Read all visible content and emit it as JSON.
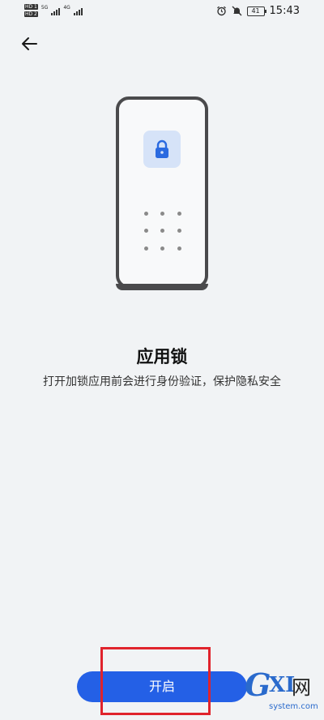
{
  "status_bar": {
    "sim1": "HD 1",
    "sim2": "HD 2",
    "net1": "5G",
    "net2": "4G",
    "battery": "41",
    "time": "15:43"
  },
  "header": {
    "back_icon": "arrow-left-icon"
  },
  "illustration": {
    "icon": "lock-icon",
    "accent": "#2a6ae0"
  },
  "content": {
    "title": "应用锁",
    "description": "打开加锁应用前会进行身份验证，保护隐私安全"
  },
  "actions": {
    "enable_label": "开启"
  },
  "watermark": {
    "logo_g": "G",
    "logo_xi": "XI",
    "logo_wang": "网",
    "url": "system.com"
  },
  "colors": {
    "primary": "#2460e6",
    "highlight": "#e0232c",
    "background": "#f1f3f5"
  }
}
